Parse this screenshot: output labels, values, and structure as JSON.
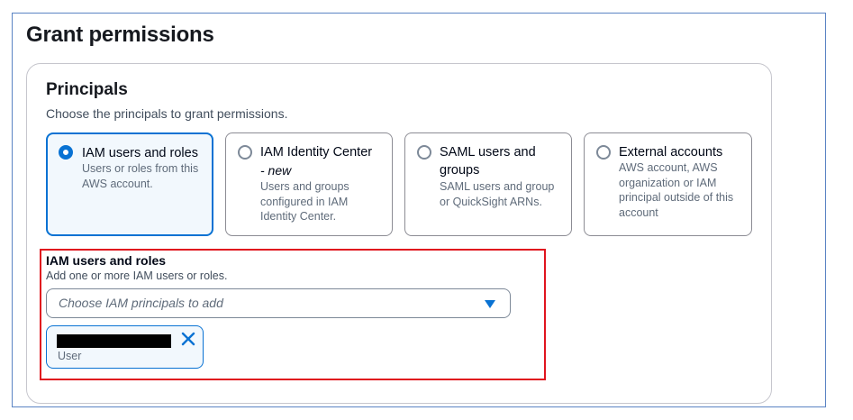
{
  "page": {
    "title": "Grant permissions"
  },
  "principals": {
    "title": "Principals",
    "description": "Choose the principals to grant permissions.",
    "options": [
      {
        "label": "IAM users and roles",
        "sub": "",
        "description": "Users or roles from this AWS account.",
        "selected": true
      },
      {
        "label": "IAM Identity Center",
        "sub": "- new",
        "description": "Users and groups configured in IAM Identity Center.",
        "selected": false
      },
      {
        "label": "SAML users and groups",
        "sub": "",
        "description": "SAML users and group or QuickSight ARNs.",
        "selected": false
      },
      {
        "label": "External accounts",
        "sub": "",
        "description": "AWS account, AWS organization or IAM principal outside of this account",
        "selected": false
      }
    ]
  },
  "iam_field": {
    "label": "IAM users and roles",
    "description": "Add one or more IAM users or roles.",
    "placeholder": "Choose IAM principals to add",
    "tokens": [
      {
        "name": "",
        "type": "User"
      }
    ]
  },
  "icons": {
    "dropdown": "caret-down-icon",
    "dismiss": "close-icon"
  },
  "colors": {
    "accent": "#0972d3",
    "highlight": "#e0141e",
    "frame": "#5b84c4"
  }
}
